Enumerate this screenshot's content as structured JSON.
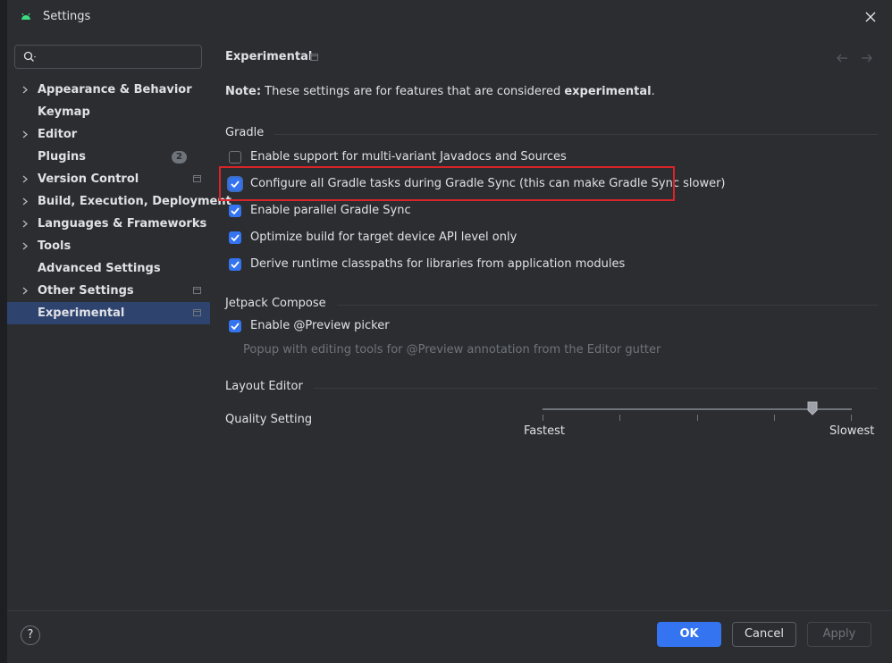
{
  "window": {
    "title": "Settings"
  },
  "sidebar": {
    "search_placeholder": "",
    "items": [
      {
        "label": "Appearance & Behavior",
        "expandable": true
      },
      {
        "label": "Keymap",
        "expandable": false
      },
      {
        "label": "Editor",
        "expandable": true
      },
      {
        "label": "Plugins",
        "expandable": false,
        "badge": "2"
      },
      {
        "label": "Version Control",
        "expandable": true,
        "project_icon": true
      },
      {
        "label": "Build, Execution, Deployment",
        "expandable": true
      },
      {
        "label": "Languages & Frameworks",
        "expandable": true
      },
      {
        "label": "Tools",
        "expandable": true
      },
      {
        "label": "Advanced Settings",
        "expandable": false
      },
      {
        "label": "Other Settings",
        "expandable": true,
        "project_icon": true
      },
      {
        "label": "Experimental",
        "expandable": false,
        "project_icon": true,
        "selected": true
      }
    ]
  },
  "page": {
    "title": "Experimental",
    "note_prefix": "Note:",
    "note_text": " These settings are for features that are considered ",
    "note_emphasis": "experimental",
    "note_suffix": "."
  },
  "gradle": {
    "section_title": "Gradle",
    "options": [
      {
        "label": "Enable support for multi-variant Javadocs and Sources",
        "checked": false
      },
      {
        "label": "Configure all Gradle tasks during Gradle Sync (this can make Gradle Sync slower)",
        "checked": true
      },
      {
        "label": "Enable parallel Gradle Sync",
        "checked": true
      },
      {
        "label": "Optimize build for target device API level only",
        "checked": true
      },
      {
        "label": "Derive runtime classpaths for libraries from application modules",
        "checked": true
      }
    ]
  },
  "compose": {
    "section_title": "Jetpack Compose",
    "option_label": "Enable @Preview picker",
    "option_checked": true,
    "hint": "Popup with editing tools for @Preview annotation from the Editor gutter"
  },
  "layout_editor": {
    "section_title": "Layout Editor",
    "quality_label": "Quality Setting",
    "slider_min_label": "Fastest",
    "slider_max_label": "Slowest",
    "slider_level": 0.875
  },
  "footer": {
    "help": "?",
    "ok": "OK",
    "cancel": "Cancel",
    "apply": "Apply"
  },
  "colors": {
    "accent": "#3574f0",
    "selection": "#2e436e",
    "highlight_box": "#d9242a",
    "android_green": "#3ddc84"
  }
}
